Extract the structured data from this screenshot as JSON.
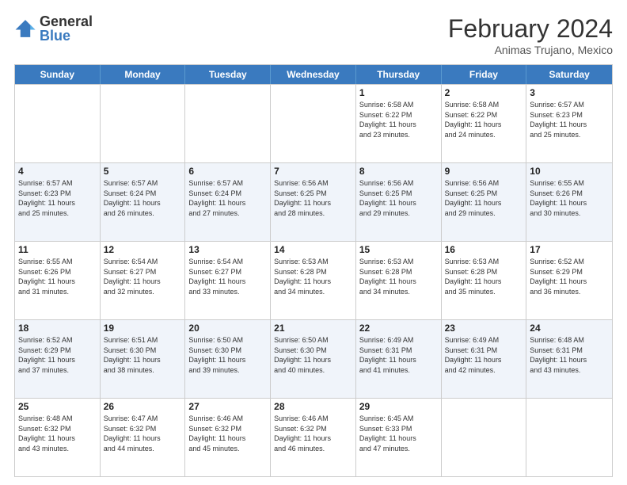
{
  "logo": {
    "general": "General",
    "blue": "Blue"
  },
  "title": "February 2024",
  "subtitle": "Animas Trujano, Mexico",
  "days": [
    "Sunday",
    "Monday",
    "Tuesday",
    "Wednesday",
    "Thursday",
    "Friday",
    "Saturday"
  ],
  "weeks": [
    [
      {
        "num": "",
        "info": ""
      },
      {
        "num": "",
        "info": ""
      },
      {
        "num": "",
        "info": ""
      },
      {
        "num": "",
        "info": ""
      },
      {
        "num": "1",
        "info": "Sunrise: 6:58 AM\nSunset: 6:22 PM\nDaylight: 11 hours\nand 23 minutes."
      },
      {
        "num": "2",
        "info": "Sunrise: 6:58 AM\nSunset: 6:22 PM\nDaylight: 11 hours\nand 24 minutes."
      },
      {
        "num": "3",
        "info": "Sunrise: 6:57 AM\nSunset: 6:23 PM\nDaylight: 11 hours\nand 25 minutes."
      }
    ],
    [
      {
        "num": "4",
        "info": "Sunrise: 6:57 AM\nSunset: 6:23 PM\nDaylight: 11 hours\nand 25 minutes."
      },
      {
        "num": "5",
        "info": "Sunrise: 6:57 AM\nSunset: 6:24 PM\nDaylight: 11 hours\nand 26 minutes."
      },
      {
        "num": "6",
        "info": "Sunrise: 6:57 AM\nSunset: 6:24 PM\nDaylight: 11 hours\nand 27 minutes."
      },
      {
        "num": "7",
        "info": "Sunrise: 6:56 AM\nSunset: 6:25 PM\nDaylight: 11 hours\nand 28 minutes."
      },
      {
        "num": "8",
        "info": "Sunrise: 6:56 AM\nSunset: 6:25 PM\nDaylight: 11 hours\nand 29 minutes."
      },
      {
        "num": "9",
        "info": "Sunrise: 6:56 AM\nSunset: 6:25 PM\nDaylight: 11 hours\nand 29 minutes."
      },
      {
        "num": "10",
        "info": "Sunrise: 6:55 AM\nSunset: 6:26 PM\nDaylight: 11 hours\nand 30 minutes."
      }
    ],
    [
      {
        "num": "11",
        "info": "Sunrise: 6:55 AM\nSunset: 6:26 PM\nDaylight: 11 hours\nand 31 minutes."
      },
      {
        "num": "12",
        "info": "Sunrise: 6:54 AM\nSunset: 6:27 PM\nDaylight: 11 hours\nand 32 minutes."
      },
      {
        "num": "13",
        "info": "Sunrise: 6:54 AM\nSunset: 6:27 PM\nDaylight: 11 hours\nand 33 minutes."
      },
      {
        "num": "14",
        "info": "Sunrise: 6:53 AM\nSunset: 6:28 PM\nDaylight: 11 hours\nand 34 minutes."
      },
      {
        "num": "15",
        "info": "Sunrise: 6:53 AM\nSunset: 6:28 PM\nDaylight: 11 hours\nand 34 minutes."
      },
      {
        "num": "16",
        "info": "Sunrise: 6:53 AM\nSunset: 6:28 PM\nDaylight: 11 hours\nand 35 minutes."
      },
      {
        "num": "17",
        "info": "Sunrise: 6:52 AM\nSunset: 6:29 PM\nDaylight: 11 hours\nand 36 minutes."
      }
    ],
    [
      {
        "num": "18",
        "info": "Sunrise: 6:52 AM\nSunset: 6:29 PM\nDaylight: 11 hours\nand 37 minutes."
      },
      {
        "num": "19",
        "info": "Sunrise: 6:51 AM\nSunset: 6:30 PM\nDaylight: 11 hours\nand 38 minutes."
      },
      {
        "num": "20",
        "info": "Sunrise: 6:50 AM\nSunset: 6:30 PM\nDaylight: 11 hours\nand 39 minutes."
      },
      {
        "num": "21",
        "info": "Sunrise: 6:50 AM\nSunset: 6:30 PM\nDaylight: 11 hours\nand 40 minutes."
      },
      {
        "num": "22",
        "info": "Sunrise: 6:49 AM\nSunset: 6:31 PM\nDaylight: 11 hours\nand 41 minutes."
      },
      {
        "num": "23",
        "info": "Sunrise: 6:49 AM\nSunset: 6:31 PM\nDaylight: 11 hours\nand 42 minutes."
      },
      {
        "num": "24",
        "info": "Sunrise: 6:48 AM\nSunset: 6:31 PM\nDaylight: 11 hours\nand 43 minutes."
      }
    ],
    [
      {
        "num": "25",
        "info": "Sunrise: 6:48 AM\nSunset: 6:32 PM\nDaylight: 11 hours\nand 43 minutes."
      },
      {
        "num": "26",
        "info": "Sunrise: 6:47 AM\nSunset: 6:32 PM\nDaylight: 11 hours\nand 44 minutes."
      },
      {
        "num": "27",
        "info": "Sunrise: 6:46 AM\nSunset: 6:32 PM\nDaylight: 11 hours\nand 45 minutes."
      },
      {
        "num": "28",
        "info": "Sunrise: 6:46 AM\nSunset: 6:32 PM\nDaylight: 11 hours\nand 46 minutes."
      },
      {
        "num": "29",
        "info": "Sunrise: 6:45 AM\nSunset: 6:33 PM\nDaylight: 11 hours\nand 47 minutes."
      },
      {
        "num": "",
        "info": ""
      },
      {
        "num": "",
        "info": ""
      }
    ]
  ]
}
